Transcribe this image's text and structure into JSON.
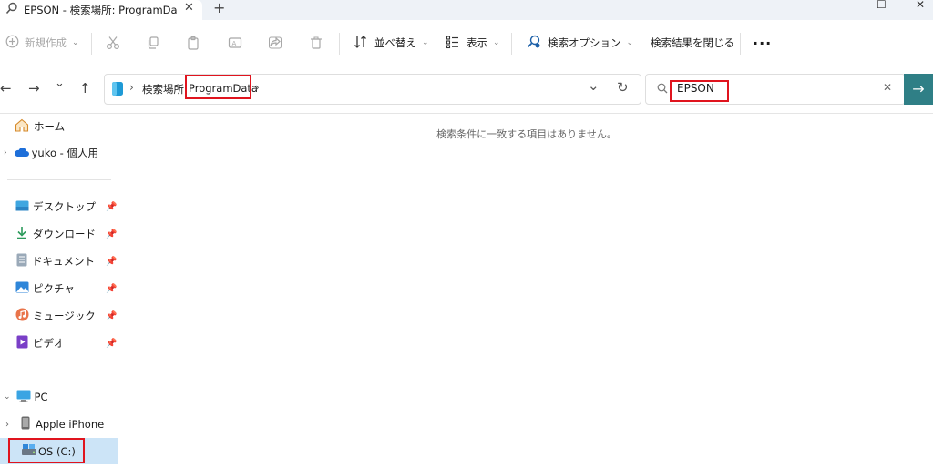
{
  "titlebar": {
    "tab_title": "EPSON - 検索場所: ProgramDa",
    "close_glyph": "✕",
    "new_tab_glyph": "+",
    "minimize_glyph": "—",
    "maximize_glyph": "☐",
    "window_close_glyph": "✕"
  },
  "commandbar": {
    "new_label": "新規作成",
    "sort_label": "並べ替え",
    "view_label": "表示",
    "search_options_label": "検索オプション",
    "close_search_label": "検索結果を閉じる",
    "more_label": "..."
  },
  "navigation": {
    "back": "←",
    "forward": "→",
    "recent": "⌄",
    "up": "↑"
  },
  "address": {
    "chevron": "›",
    "search_location_prefix": "検索場所:",
    "location": "ProgramData",
    "dropdown": "⌄",
    "refresh": "↻"
  },
  "search": {
    "query": "EPSON",
    "clear": "✕",
    "go": "→"
  },
  "sidebar": {
    "home": "ホーム",
    "onedrive": "yuko - 個人用",
    "desktop": "デスクトップ",
    "downloads": "ダウンロード",
    "documents": "ドキュメント",
    "pictures": "ピクチャ",
    "music": "ミュージック",
    "videos": "ビデオ",
    "pc": "PC",
    "iphone": "Apple iPhone",
    "os_drive": "OS (C:)"
  },
  "main": {
    "empty_message": "検索条件に一致する項目はありません。"
  },
  "colors": {
    "accent": "#2f7f86",
    "highlight_box": "#e0141e",
    "selected_bg": "#cce4f7"
  }
}
